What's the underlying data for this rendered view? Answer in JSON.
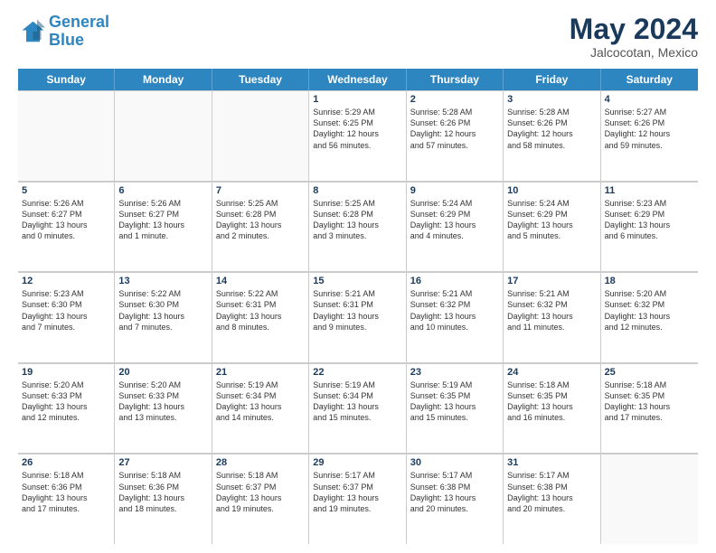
{
  "logo": {
    "line1": "General",
    "line2": "Blue"
  },
  "title": "May 2024",
  "location": "Jalcocotan, Mexico",
  "days_of_week": [
    "Sunday",
    "Monday",
    "Tuesday",
    "Wednesday",
    "Thursday",
    "Friday",
    "Saturday"
  ],
  "weeks": [
    [
      {
        "day": "",
        "empty": true
      },
      {
        "day": "",
        "empty": true
      },
      {
        "day": "",
        "empty": true
      },
      {
        "day": "1",
        "info": "Sunrise: 5:29 AM\nSunset: 6:25 PM\nDaylight: 12 hours\nand 56 minutes."
      },
      {
        "day": "2",
        "info": "Sunrise: 5:28 AM\nSunset: 6:26 PM\nDaylight: 12 hours\nand 57 minutes."
      },
      {
        "day": "3",
        "info": "Sunrise: 5:28 AM\nSunset: 6:26 PM\nDaylight: 12 hours\nand 58 minutes."
      },
      {
        "day": "4",
        "info": "Sunrise: 5:27 AM\nSunset: 6:26 PM\nDaylight: 12 hours\nand 59 minutes."
      }
    ],
    [
      {
        "day": "5",
        "info": "Sunrise: 5:26 AM\nSunset: 6:27 PM\nDaylight: 13 hours\nand 0 minutes."
      },
      {
        "day": "6",
        "info": "Sunrise: 5:26 AM\nSunset: 6:27 PM\nDaylight: 13 hours\nand 1 minute."
      },
      {
        "day": "7",
        "info": "Sunrise: 5:25 AM\nSunset: 6:28 PM\nDaylight: 13 hours\nand 2 minutes."
      },
      {
        "day": "8",
        "info": "Sunrise: 5:25 AM\nSunset: 6:28 PM\nDaylight: 13 hours\nand 3 minutes."
      },
      {
        "day": "9",
        "info": "Sunrise: 5:24 AM\nSunset: 6:29 PM\nDaylight: 13 hours\nand 4 minutes."
      },
      {
        "day": "10",
        "info": "Sunrise: 5:24 AM\nSunset: 6:29 PM\nDaylight: 13 hours\nand 5 minutes."
      },
      {
        "day": "11",
        "info": "Sunrise: 5:23 AM\nSunset: 6:29 PM\nDaylight: 13 hours\nand 6 minutes."
      }
    ],
    [
      {
        "day": "12",
        "info": "Sunrise: 5:23 AM\nSunset: 6:30 PM\nDaylight: 13 hours\nand 7 minutes."
      },
      {
        "day": "13",
        "info": "Sunrise: 5:22 AM\nSunset: 6:30 PM\nDaylight: 13 hours\nand 7 minutes."
      },
      {
        "day": "14",
        "info": "Sunrise: 5:22 AM\nSunset: 6:31 PM\nDaylight: 13 hours\nand 8 minutes."
      },
      {
        "day": "15",
        "info": "Sunrise: 5:21 AM\nSunset: 6:31 PM\nDaylight: 13 hours\nand 9 minutes."
      },
      {
        "day": "16",
        "info": "Sunrise: 5:21 AM\nSunset: 6:32 PM\nDaylight: 13 hours\nand 10 minutes."
      },
      {
        "day": "17",
        "info": "Sunrise: 5:21 AM\nSunset: 6:32 PM\nDaylight: 13 hours\nand 11 minutes."
      },
      {
        "day": "18",
        "info": "Sunrise: 5:20 AM\nSunset: 6:32 PM\nDaylight: 13 hours\nand 12 minutes."
      }
    ],
    [
      {
        "day": "19",
        "info": "Sunrise: 5:20 AM\nSunset: 6:33 PM\nDaylight: 13 hours\nand 12 minutes."
      },
      {
        "day": "20",
        "info": "Sunrise: 5:20 AM\nSunset: 6:33 PM\nDaylight: 13 hours\nand 13 minutes."
      },
      {
        "day": "21",
        "info": "Sunrise: 5:19 AM\nSunset: 6:34 PM\nDaylight: 13 hours\nand 14 minutes."
      },
      {
        "day": "22",
        "info": "Sunrise: 5:19 AM\nSunset: 6:34 PM\nDaylight: 13 hours\nand 15 minutes."
      },
      {
        "day": "23",
        "info": "Sunrise: 5:19 AM\nSunset: 6:35 PM\nDaylight: 13 hours\nand 15 minutes."
      },
      {
        "day": "24",
        "info": "Sunrise: 5:18 AM\nSunset: 6:35 PM\nDaylight: 13 hours\nand 16 minutes."
      },
      {
        "day": "25",
        "info": "Sunrise: 5:18 AM\nSunset: 6:35 PM\nDaylight: 13 hours\nand 17 minutes."
      }
    ],
    [
      {
        "day": "26",
        "info": "Sunrise: 5:18 AM\nSunset: 6:36 PM\nDaylight: 13 hours\nand 17 minutes."
      },
      {
        "day": "27",
        "info": "Sunrise: 5:18 AM\nSunset: 6:36 PM\nDaylight: 13 hours\nand 18 minutes."
      },
      {
        "day": "28",
        "info": "Sunrise: 5:18 AM\nSunset: 6:37 PM\nDaylight: 13 hours\nand 19 minutes."
      },
      {
        "day": "29",
        "info": "Sunrise: 5:17 AM\nSunset: 6:37 PM\nDaylight: 13 hours\nand 19 minutes."
      },
      {
        "day": "30",
        "info": "Sunrise: 5:17 AM\nSunset: 6:38 PM\nDaylight: 13 hours\nand 20 minutes."
      },
      {
        "day": "31",
        "info": "Sunrise: 5:17 AM\nSunset: 6:38 PM\nDaylight: 13 hours\nand 20 minutes."
      },
      {
        "day": "",
        "empty": true
      }
    ]
  ]
}
